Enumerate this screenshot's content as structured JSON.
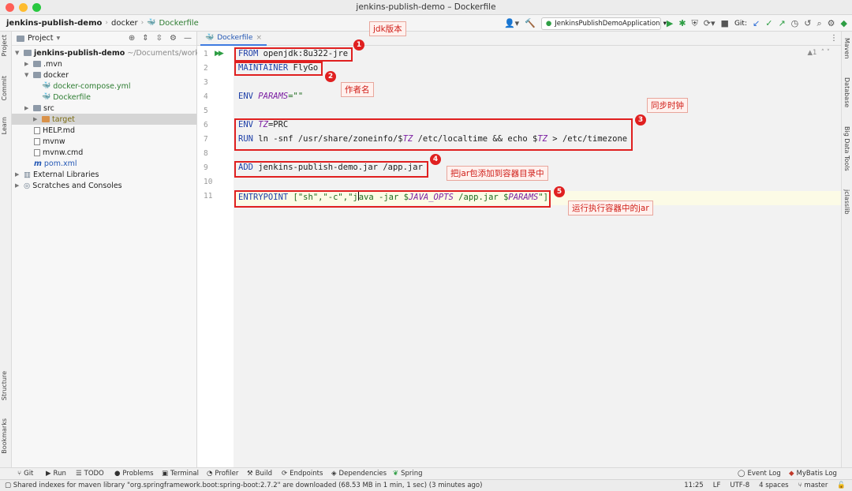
{
  "window": {
    "title": "jenkins-publish-demo – Dockerfile"
  },
  "breadcrumb": {
    "project": "jenkins-publish-demo",
    "folder": "docker",
    "file": "Dockerfile"
  },
  "toolbar": {
    "run_config": "JenkinsPublishDemoApplication",
    "git_label": "Git:"
  },
  "left_stripe": {
    "project": "Project",
    "commit": "Commit",
    "learn": "Learn",
    "structure": "Structure",
    "bookmarks": "Bookmarks"
  },
  "project_panel": {
    "header": "Project",
    "tree": {
      "root": "jenkins-publish-demo",
      "root_path": "~/Documents/workspace",
      "mvn": ".mvn",
      "docker": "docker",
      "compose": "docker-compose.yml",
      "dockerfile": "Dockerfile",
      "src": "src",
      "target": "target",
      "help": "HELP.md",
      "mvnw": "mvnw",
      "mvnw_cmd": "mvnw.cmd",
      "pom": "pom.xml",
      "ext_libs": "External Libraries",
      "scratches": "Scratches and Consoles"
    }
  },
  "editor": {
    "tab": "Dockerfile",
    "hint": "▲1",
    "line_numbers": [
      "1",
      "2",
      "3",
      "4",
      "5",
      "6",
      "7",
      "8",
      "9",
      "10",
      "11"
    ],
    "lines": {
      "l1": {
        "kw": "FROM",
        "rest": " openjdk:8u322-jre"
      },
      "l2": {
        "kw": "MAINTAINER",
        "rest": " FlyGo"
      },
      "l4": {
        "kw": "ENV",
        "var": "PARAMS",
        "rest": "=\"\""
      },
      "l6": {
        "kw": "ENV",
        "var": "TZ",
        "rest": "=PRC"
      },
      "l7": {
        "kw": "RUN",
        "a": " ln -snf /usr/share/zoneinfo/$",
        "v1": "TZ",
        "b": " /etc/localtime && echo $",
        "v2": "TZ",
        "c": " > /etc/timezone"
      },
      "l9": {
        "kw": "ADD",
        "rest": " jenkins-publish-demo.jar /app.jar"
      },
      "l11": {
        "kw": "ENTRYPOINT",
        "a": " [\"sh\",\"-c\",\"j",
        "b": "ava -jar $",
        "v1": "JAVA_OPTS",
        "c": " /app.jar $",
        "v2": "PARAMS",
        "d": "\"]"
      }
    }
  },
  "annotations": [
    {
      "n": "1",
      "text": "jdk版本"
    },
    {
      "n": "2",
      "text": "作者名"
    },
    {
      "n": "3",
      "text": "同步时钟"
    },
    {
      "n": "4",
      "text": "把jar包添加到容器目录中"
    },
    {
      "n": "5",
      "text": "运行执行容器中的jar"
    }
  ],
  "right_stripe": {
    "maven": "Maven",
    "database": "Database",
    "bigdata": "Big Data Tools",
    "jclasslib": "jclasslib"
  },
  "bottom_tools": {
    "git": "Git",
    "run": "Run",
    "todo": "TODO",
    "problems": "Problems",
    "terminal": "Terminal",
    "profiler": "Profiler",
    "build": "Build",
    "endpoints": "Endpoints",
    "dependencies": "Dependencies",
    "spring": "Spring",
    "event_log": "Event Log",
    "mybatis_log": "MyBatis Log"
  },
  "status": {
    "message": "Shared indexes for maven library \"org.springframework.boot:spring-boot:2.7.2\" are downloaded (68.53 MB in 1 min, 1 sec) (3 minutes ago)",
    "position": "11:25",
    "line_sep": "LF",
    "encoding": "UTF-8",
    "indent": "4 spaces",
    "branch": "master"
  }
}
